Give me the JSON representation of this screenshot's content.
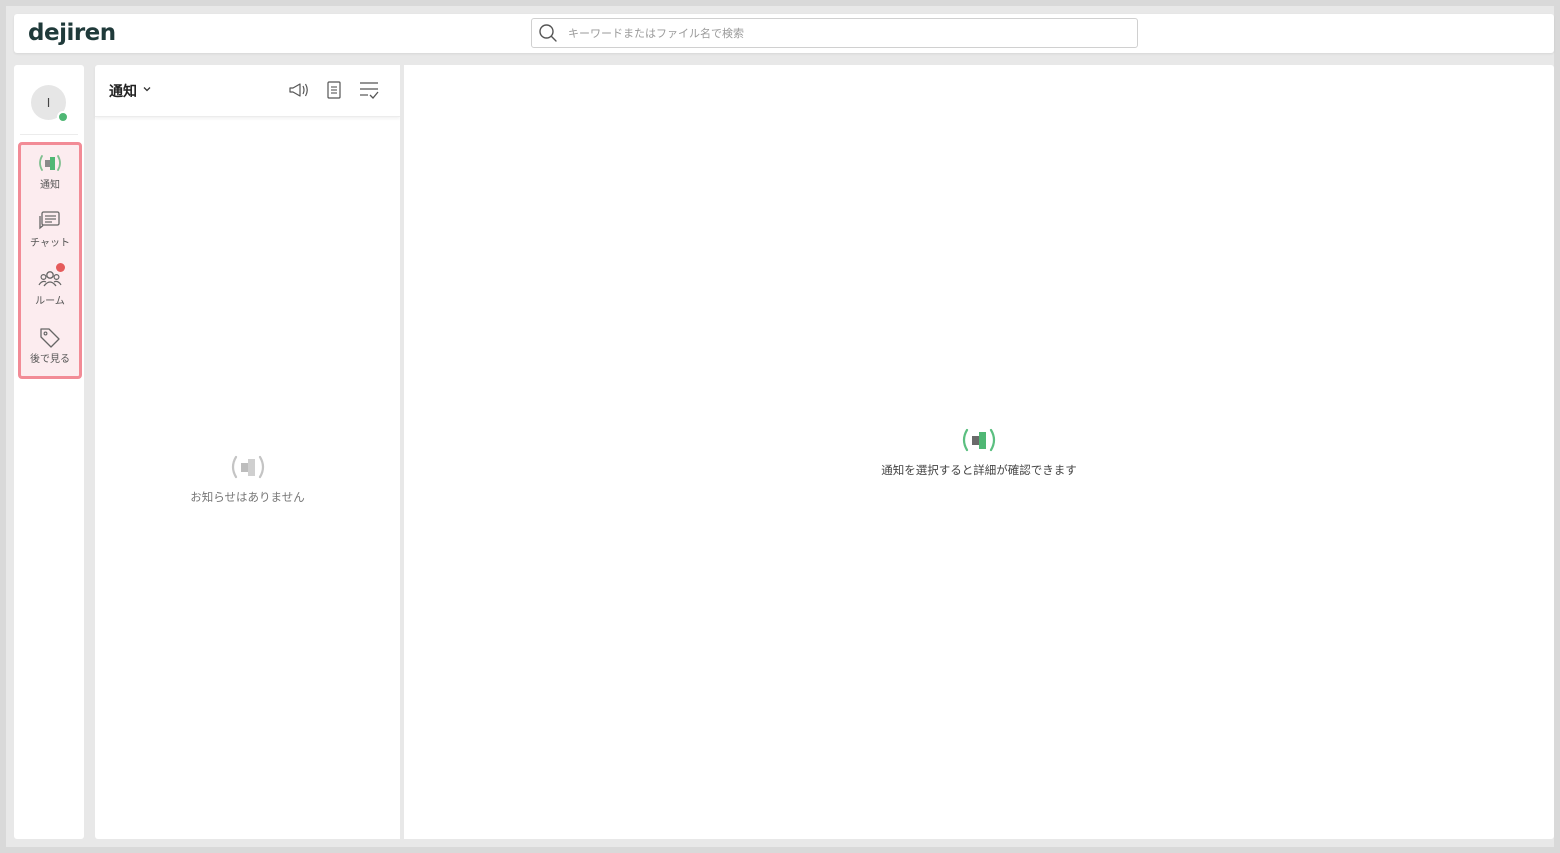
{
  "app": {
    "logo": "dejiren"
  },
  "search": {
    "placeholder": "キーワードまたはファイル名で検索"
  },
  "user": {
    "initial": "I",
    "status": "online"
  },
  "nav": {
    "items": [
      {
        "label": "通知",
        "icon": "megaphone-icon",
        "active": true
      },
      {
        "label": "チャット",
        "icon": "chat-icon"
      },
      {
        "label": "ルーム",
        "icon": "room-icon",
        "has_badge": true
      },
      {
        "label": "後で見る",
        "icon": "tag-icon"
      }
    ]
  },
  "list": {
    "title": "通知",
    "empty_text": "お知らせはありません",
    "header_icons": [
      "announcement-icon",
      "document-icon",
      "mark-all-read-icon"
    ]
  },
  "detail": {
    "empty_text": "通知を選択すると詳細が確認できます"
  },
  "colors": {
    "accent_green": "#4fb774",
    "highlight_border": "#f28b96",
    "badge_red": "#e55b5b"
  }
}
